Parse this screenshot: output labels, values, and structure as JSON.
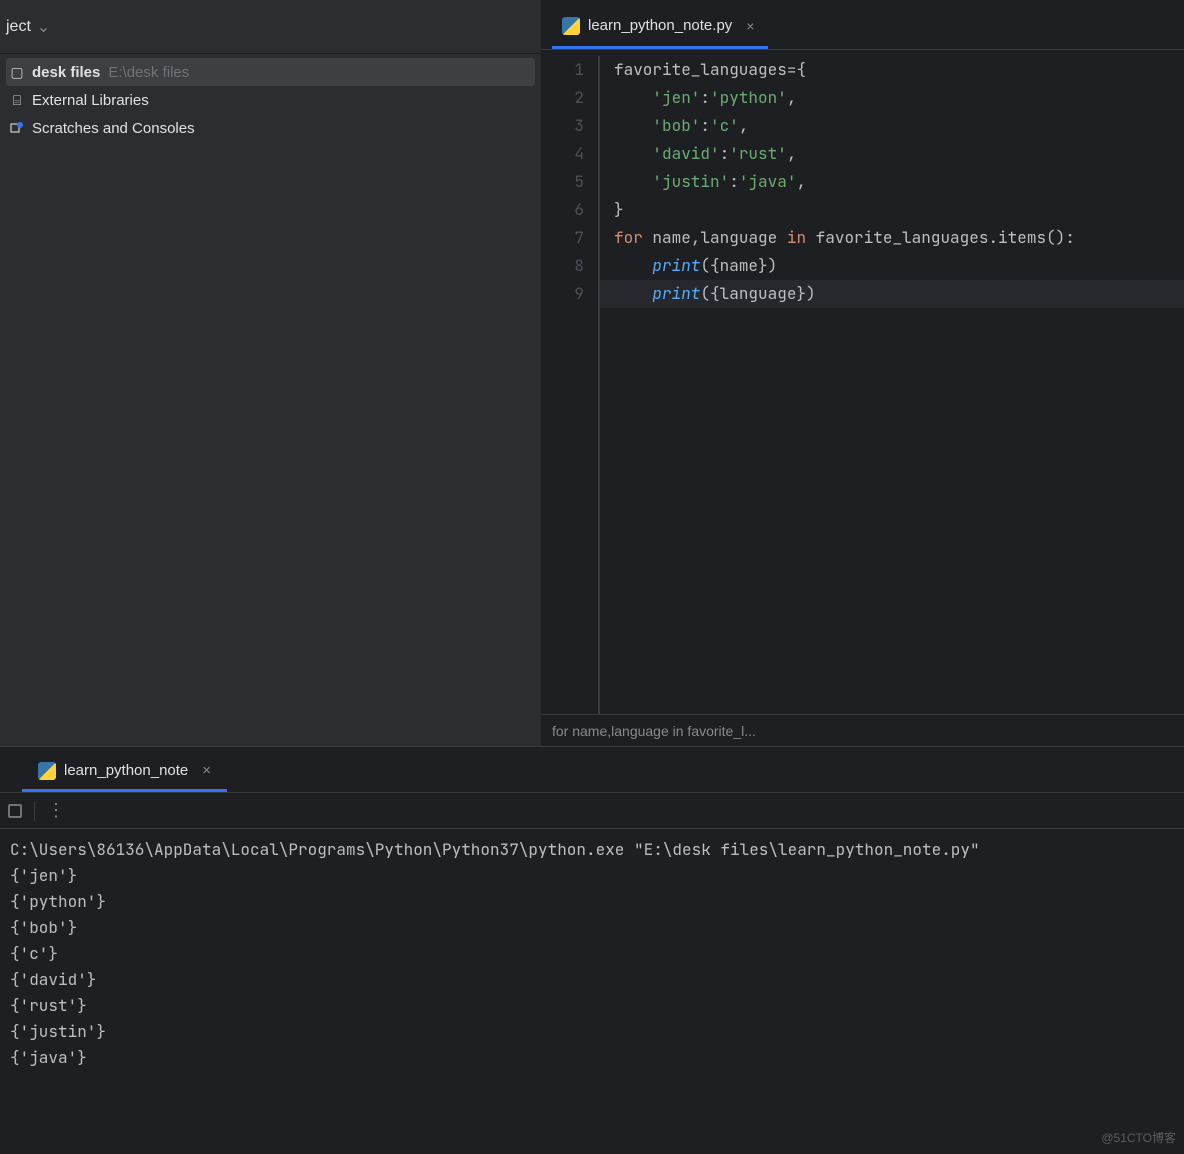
{
  "sidebar": {
    "header_label": "ject",
    "items": [
      {
        "label": "desk files",
        "path": "E:\\desk files",
        "icon": "folder",
        "selected": true,
        "bold": true
      },
      {
        "label": "External Libraries",
        "icon": "library",
        "selected": false
      },
      {
        "label": "Scratches and Consoles",
        "icon": "scratch",
        "selected": false
      }
    ]
  },
  "editor": {
    "tab": {
      "filename": "learn_python_note.py"
    },
    "line_numbers": [
      "1",
      "2",
      "3",
      "4",
      "5",
      "6",
      "7",
      "8",
      "9"
    ],
    "code_lines": [
      [
        {
          "t": "favorite_languages",
          "c": "op"
        },
        {
          "t": "=",
          "c": "op"
        },
        {
          "t": "{",
          "c": "op"
        }
      ],
      [
        {
          "t": "    ",
          "c": "op"
        },
        {
          "t": "'jen'",
          "c": "str"
        },
        {
          "t": ":",
          "c": "op"
        },
        {
          "t": "'python'",
          "c": "str"
        },
        {
          "t": ",",
          "c": "op"
        }
      ],
      [
        {
          "t": "    ",
          "c": "op"
        },
        {
          "t": "'bob'",
          "c": "str"
        },
        {
          "t": ":",
          "c": "op"
        },
        {
          "t": "'c'",
          "c": "str"
        },
        {
          "t": ",",
          "c": "op"
        }
      ],
      [
        {
          "t": "    ",
          "c": "op"
        },
        {
          "t": "'david'",
          "c": "str"
        },
        {
          "t": ":",
          "c": "op"
        },
        {
          "t": "'rust'",
          "c": "str"
        },
        {
          "t": ",",
          "c": "op"
        }
      ],
      [
        {
          "t": "    ",
          "c": "op"
        },
        {
          "t": "'justin'",
          "c": "str"
        },
        {
          "t": ":",
          "c": "op"
        },
        {
          "t": "'java'",
          "c": "str"
        },
        {
          "t": ",",
          "c": "op"
        }
      ],
      [
        {
          "t": "}",
          "c": "op"
        }
      ],
      [
        {
          "t": "for",
          "c": "kw"
        },
        {
          "t": " name",
          "c": "op"
        },
        {
          "t": ",",
          "c": "op"
        },
        {
          "t": "language ",
          "c": "op"
        },
        {
          "t": "in",
          "c": "kw"
        },
        {
          "t": " favorite_languages.items():",
          "c": "op"
        }
      ],
      [
        {
          "t": "    ",
          "c": "op"
        },
        {
          "t": "print",
          "c": "fn"
        },
        {
          "t": "({name})",
          "c": "op"
        }
      ],
      [
        {
          "t": "    ",
          "c": "op"
        },
        {
          "t": "print",
          "c": "fn"
        },
        {
          "t": "({language})",
          "c": "op"
        }
      ]
    ],
    "current_line": 9,
    "breadcrumb": "for name,language in favorite_l..."
  },
  "run": {
    "tab_label": "learn_python_note",
    "output_lines": [
      "C:\\Users\\86136\\AppData\\Local\\Programs\\Python\\Python37\\python.exe \"E:\\desk files\\learn_python_note.py\"",
      "{'jen'}",
      "{'python'}",
      "{'bob'}",
      "{'c'}",
      "{'david'}",
      "{'rust'}",
      "{'justin'}",
      "{'java'}"
    ]
  },
  "watermark": "@51CTO博客"
}
